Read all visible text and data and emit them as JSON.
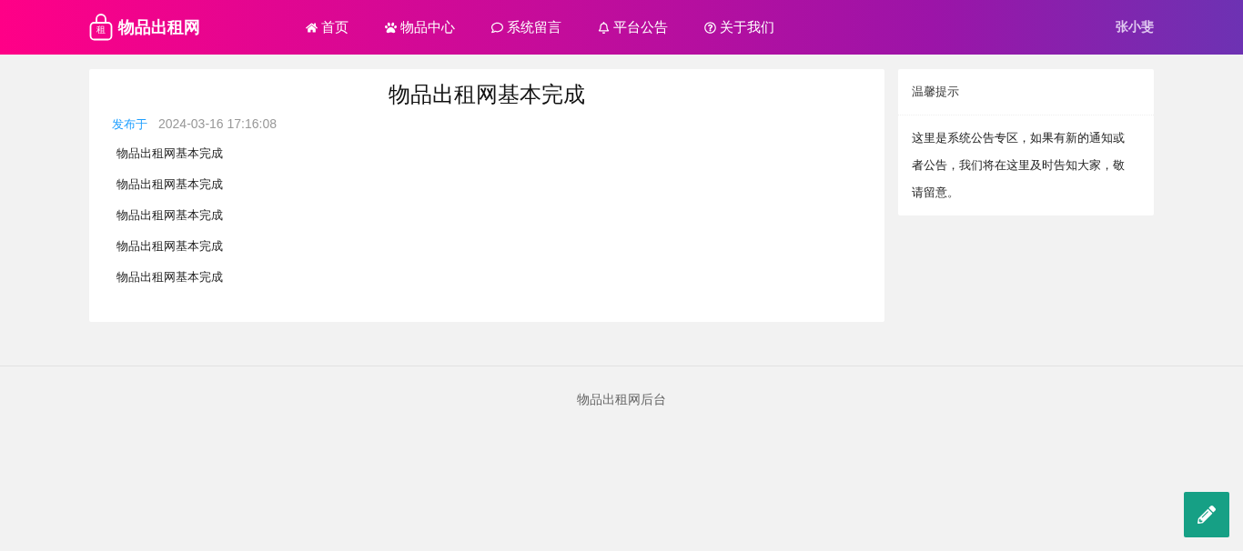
{
  "header": {
    "logo_text": "物品出租网",
    "logo_badge": "租",
    "nav": [
      "首页",
      "物品中心",
      "系统留言",
      "平台公告",
      "关于我们"
    ],
    "user": "张小斐"
  },
  "article": {
    "title": "物品出租网基本完成",
    "published_label": "发布于",
    "published_at": "2024-03-16 17:16:08",
    "paragraphs": [
      "物品出租网基本完成",
      "物品出租网基本完成",
      "物品出租网基本完成",
      "物品出租网基本完成",
      "物品出租网基本完成"
    ]
  },
  "notice": {
    "title": "温馨提示",
    "body": "这里是系统公告专区，如果有新的通知或者公告，我们将在这里及时告知大家，敬请留意。"
  },
  "footer": {
    "text": "物品出租网后台"
  }
}
